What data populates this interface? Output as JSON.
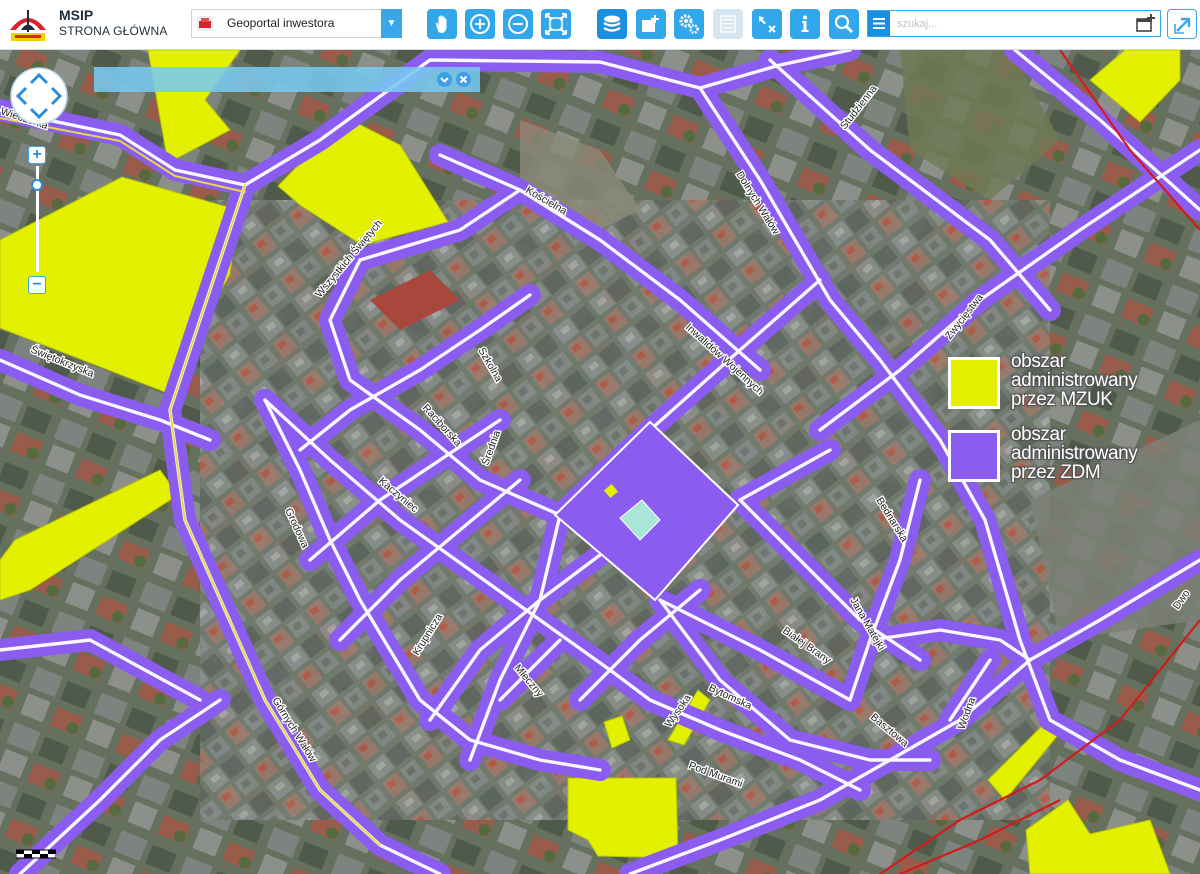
{
  "app": {
    "title": "MSIP",
    "subtitle": "STRONA GŁÓWNA"
  },
  "portal": {
    "selected": "Geoportal inwestora"
  },
  "toolbar": {
    "tools": [
      "pan-hand-icon",
      "zoom-in-icon",
      "zoom-out-icon",
      "full-extent-icon",
      "layers-icon",
      "add-window-icon",
      "settings-icon",
      "list-icon",
      "select-arrow-icon",
      "info-icon",
      "search-icon"
    ],
    "colors": {
      "primary": "#32a7ec",
      "dark": "#1a8fe0",
      "disabled": "#d6e6f2"
    }
  },
  "search": {
    "placeholder": "szukaj..."
  },
  "map": {
    "colors": {
      "zdm": "#8a5cf0",
      "mzuk": "#e3f000",
      "road_edge": "#ffffff",
      "rail": "#d31b1b"
    },
    "streets": [
      "Wieczorka",
      "Świętokrzyska",
      "Wszystkich Świętych",
      "Kościelna",
      "Studzienna",
      "Dolnych Wałów",
      "Zwycięstwa",
      "Inwalidów Wojennych",
      "Szkolna",
      "Raciborska",
      "Średnia",
      "Kaczyniec",
      "Grodowa",
      "Bednarska",
      "Krupnicza",
      "Jana Matejki",
      "Białej Brany",
      "Bytomska",
      "Mleczny",
      "Wysoka",
      "Basztowa",
      "Wodna",
      "Pod Murami",
      "Górnych Wałów",
      "Dwo"
    ]
  },
  "legend": {
    "items": [
      {
        "label_lines": [
          "obszar",
          "administrowany",
          "przez MZUK"
        ],
        "color": "#e3f000"
      },
      {
        "label_lines": [
          "obszar",
          "administrowany",
          "przez ZDM"
        ],
        "color": "#8a5cf0"
      }
    ]
  }
}
